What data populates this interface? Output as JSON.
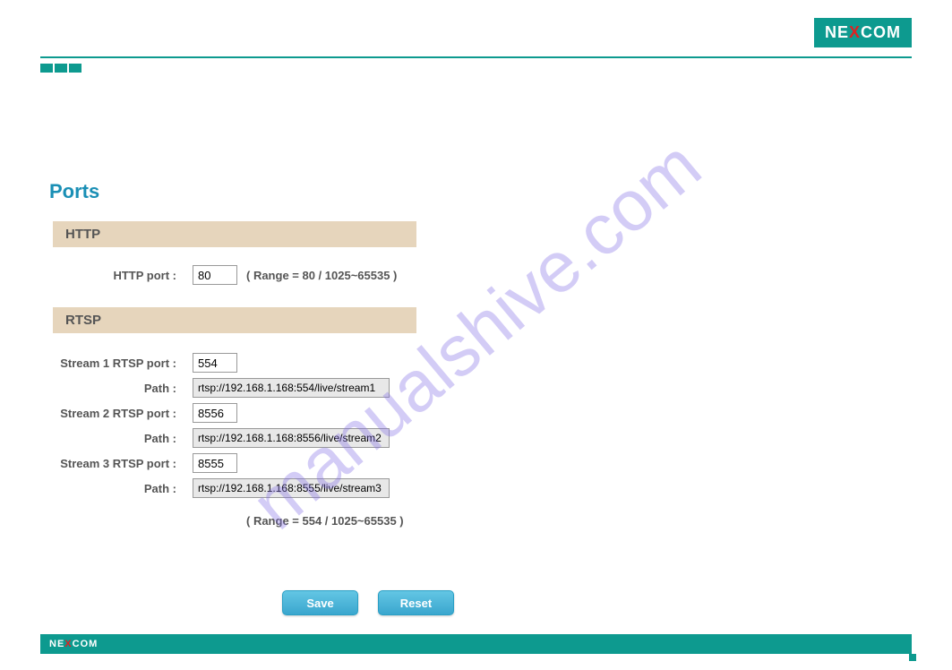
{
  "brand": "NEXCOM",
  "page_title": "Ports",
  "sections": {
    "http": {
      "header": "HTTP",
      "port_label": "HTTP port :",
      "port_value": "80",
      "range_hint": "( Range = 80 / 1025~65535 )"
    },
    "rtsp": {
      "header": "RTSP",
      "path_label": "Path :",
      "range_hint": "( Range = 554 / 1025~65535 )",
      "streams": [
        {
          "port_label": "Stream 1 RTSP port :",
          "port_value": "554",
          "path_value": "rtsp://192.168.1.168:554/live/stream1"
        },
        {
          "port_label": "Stream 2 RTSP port :",
          "port_value": "8556",
          "path_value": "rtsp://192.168.1.168:8556/live/stream2"
        },
        {
          "port_label": "Stream 3 RTSP port :",
          "port_value": "8555",
          "path_value": "rtsp://192.168.1.168:8555/live/stream3"
        }
      ]
    }
  },
  "buttons": {
    "save": "Save",
    "reset": "Reset"
  },
  "watermark": "manualshive.com"
}
